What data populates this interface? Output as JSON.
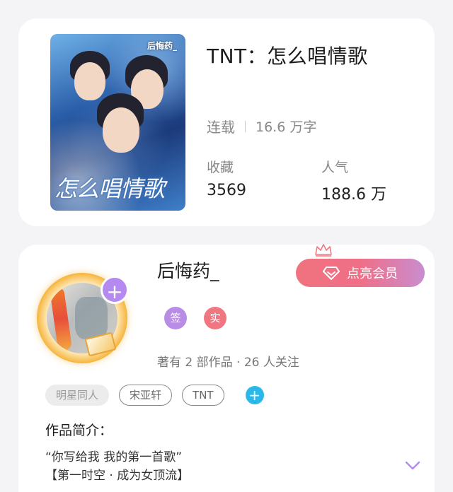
{
  "book": {
    "title": "TNT：怎么唱情歌",
    "status": "连载",
    "word_count": "16.6 万字",
    "favorites_label": "收藏",
    "favorites_value": "3569",
    "popularity_label": "人气",
    "popularity_value": "188.6 万",
    "cover_author": "后悔药_",
    "cover_title": "怎么唱情歌"
  },
  "author": {
    "name": "后悔药_",
    "vip_label": "点亮会员",
    "badge_sign": "签",
    "badge_real": "实",
    "stats": "著有 2 部作品 · 26 人关注",
    "add_avatar_symbol": "+"
  },
  "tags": {
    "items": [
      "明星同人",
      "宋亚轩",
      "TNT"
    ],
    "add_symbol": "+"
  },
  "intro": {
    "title": "作品简介：",
    "line1": "“你写给我 我的第一首歌”",
    "line2": "【第一时空 · 成为女顶流】"
  },
  "colors": {
    "vip_gradient_start": "#f0737f",
    "vip_gradient_end": "#c98dd0",
    "badge_sign": "#b98de6",
    "badge_real": "#f07782",
    "add_tag": "#2bb8e8",
    "expand_chevron": "#b48af0"
  }
}
